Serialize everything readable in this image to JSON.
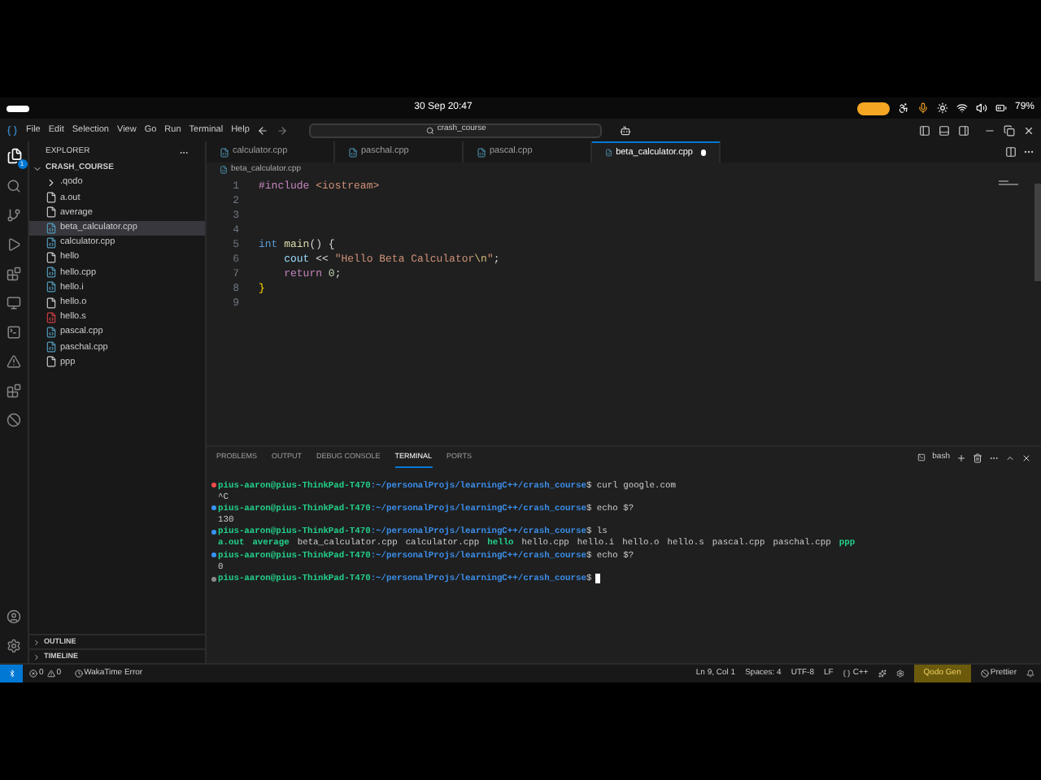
{
  "system_bar": {
    "clock": "30 Sep  20:47",
    "battery": "79%"
  },
  "menu": [
    "File",
    "Edit",
    "Selection",
    "View",
    "Go",
    "Run",
    "Terminal",
    "Help"
  ],
  "search": {
    "value": "crash_course"
  },
  "activity_bar": {
    "badge": "1"
  },
  "explorer": {
    "title": "EXPLORER",
    "folder": "CRASH_COURSE",
    "items": [
      {
        "name": ".qodo",
        "kind": "folder",
        "selected": false
      },
      {
        "name": "a.out",
        "kind": "binary",
        "selected": false
      },
      {
        "name": "average",
        "kind": "binary",
        "selected": false
      },
      {
        "name": "beta_calculator.cpp",
        "kind": "cpp",
        "selected": true
      },
      {
        "name": "calculator.cpp",
        "kind": "cpp",
        "selected": false
      },
      {
        "name": "hello",
        "kind": "binary",
        "selected": false
      },
      {
        "name": "hello.cpp",
        "kind": "cpp",
        "selected": false
      },
      {
        "name": "hello.i",
        "kind": "c",
        "selected": false
      },
      {
        "name": "hello.o",
        "kind": "binary",
        "selected": false
      },
      {
        "name": "hello.s",
        "kind": "asm",
        "selected": false
      },
      {
        "name": "pascal.cpp",
        "kind": "cpp",
        "selected": false
      },
      {
        "name": "paschal.cpp",
        "kind": "cpp",
        "selected": false
      },
      {
        "name": "ppp",
        "kind": "binary",
        "selected": false
      }
    ],
    "sections": [
      "OUTLINE",
      "TIMELINE"
    ]
  },
  "tabs": [
    {
      "label": "calculator.cpp",
      "selected": false,
      "modified": false
    },
    {
      "label": "paschal.cpp",
      "selected": false,
      "modified": false
    },
    {
      "label": "pascal.cpp",
      "selected": false,
      "modified": false
    },
    {
      "label": "beta_calculator.cpp",
      "selected": true,
      "modified": true
    }
  ],
  "breadcrumb": "beta_calculator.cpp",
  "editor": {
    "lines": [
      {
        "number": "1",
        "tokens": [
          {
            "text": "#include",
            "kind": "directive"
          },
          {
            "text": " <iostream>",
            "kind": "string"
          }
        ]
      },
      {
        "number": "2"
      },
      {
        "number": "3"
      },
      {
        "number": "4"
      },
      {
        "number": "5",
        "tokens": [
          {
            "text": "int",
            "kind": "type"
          },
          {
            "text": " main",
            "kind": "function"
          },
          {
            "text": "() {",
            "kind": "plain"
          }
        ]
      },
      {
        "number": "6",
        "tokens": [
          {
            "text": "    cout",
            "kind": "variable"
          },
          {
            "text": " << ",
            "kind": "plain"
          },
          {
            "text": "\"Hello Beta Calculator",
            "kind": "string"
          },
          {
            "text": "\\n",
            "kind": "escape"
          },
          {
            "text": "\"",
            "kind": "string"
          },
          {
            "text": ";",
            "kind": "plain"
          }
        ]
      },
      {
        "number": "7",
        "tokens": [
          {
            "text": "    return",
            "kind": "directive"
          },
          {
            "text": " 0",
            "kind": "number"
          },
          {
            "text": ";",
            "kind": "plain"
          }
        ]
      },
      {
        "number": "8",
        "tokens": [
          {
            "text": "}",
            "kind": "bracket"
          }
        ]
      },
      {
        "number": "9"
      }
    ]
  },
  "panel": {
    "tabs": [
      {
        "label": "PROBLEMS",
        "selected": false
      },
      {
        "label": "OUTPUT",
        "selected": false
      },
      {
        "label": "DEBUG CONSOLE",
        "selected": false
      },
      {
        "label": "TERMINAL",
        "selected": true
      },
      {
        "label": "PORTS",
        "selected": false
      }
    ],
    "shell": "bash"
  },
  "terminal": [
    {
      "kind": "prompt",
      "color": "#f14c4c",
      "user": "pius-aaron@pius-ThinkPad-T470",
      "path": ":~/personalProjs/learningC++/crash_course",
      "command": "$ curl google.com"
    },
    {
      "kind": "output",
      "text": "^C"
    },
    {
      "kind": "prompt",
      "color": "#3794ff",
      "user": "pius-aaron@pius-ThinkPad-T470",
      "path": ":~/personalProjs/learningC++/crash_course",
      "command": "$ echo $?"
    },
    {
      "kind": "output",
      "text": "130"
    },
    {
      "kind": "prompt",
      "color": "#3794ff",
      "user": "pius-aaron@pius-ThinkPad-T470",
      "path": ":~/personalProjs/learningC++/crash_course",
      "command": "$ ls"
    },
    {
      "kind": "listing",
      "entries": [
        {
          "text": "a.out",
          "kind": "exec"
        },
        {
          "text": "average",
          "kind": "exec"
        },
        {
          "text": "beta_calculator.cpp",
          "kind": "file"
        },
        {
          "text": "calculator.cpp",
          "kind": "file"
        },
        {
          "text": "hello",
          "kind": "exec"
        },
        {
          "text": "hello.cpp",
          "kind": "file"
        },
        {
          "text": "hello.i",
          "kind": "file"
        },
        {
          "text": "hello.o",
          "kind": "file"
        },
        {
          "text": "hello.s",
          "kind": "file"
        },
        {
          "text": "pascal.cpp",
          "kind": "file"
        },
        {
          "text": "paschal.cpp",
          "kind": "file"
        },
        {
          "text": "ppp",
          "kind": "exec"
        }
      ]
    },
    {
      "kind": "prompt",
      "color": "#3794ff",
      "user": "pius-aaron@pius-ThinkPad-T470",
      "path": ":~/personalProjs/learningC++/crash_course",
      "command": "$ echo $?"
    },
    {
      "kind": "output",
      "text": "0"
    },
    {
      "kind": "prompt",
      "color": "#8a8a8a",
      "cursor": true,
      "user": "pius-aaron@pius-ThinkPad-T470",
      "path": ":~/personalProjs/learningC++/crash_course",
      "command": "$"
    }
  ],
  "status_bar": {
    "errors": "0",
    "warnings": "0",
    "wakatime": "WakaTime Error",
    "position": "Ln 9, Col 1",
    "spaces": "Spaces: 4",
    "encoding": "UTF-8",
    "eol": "LF",
    "language": "C++",
    "qodo": "Qodo Gen",
    "prettier": "Prettier"
  }
}
